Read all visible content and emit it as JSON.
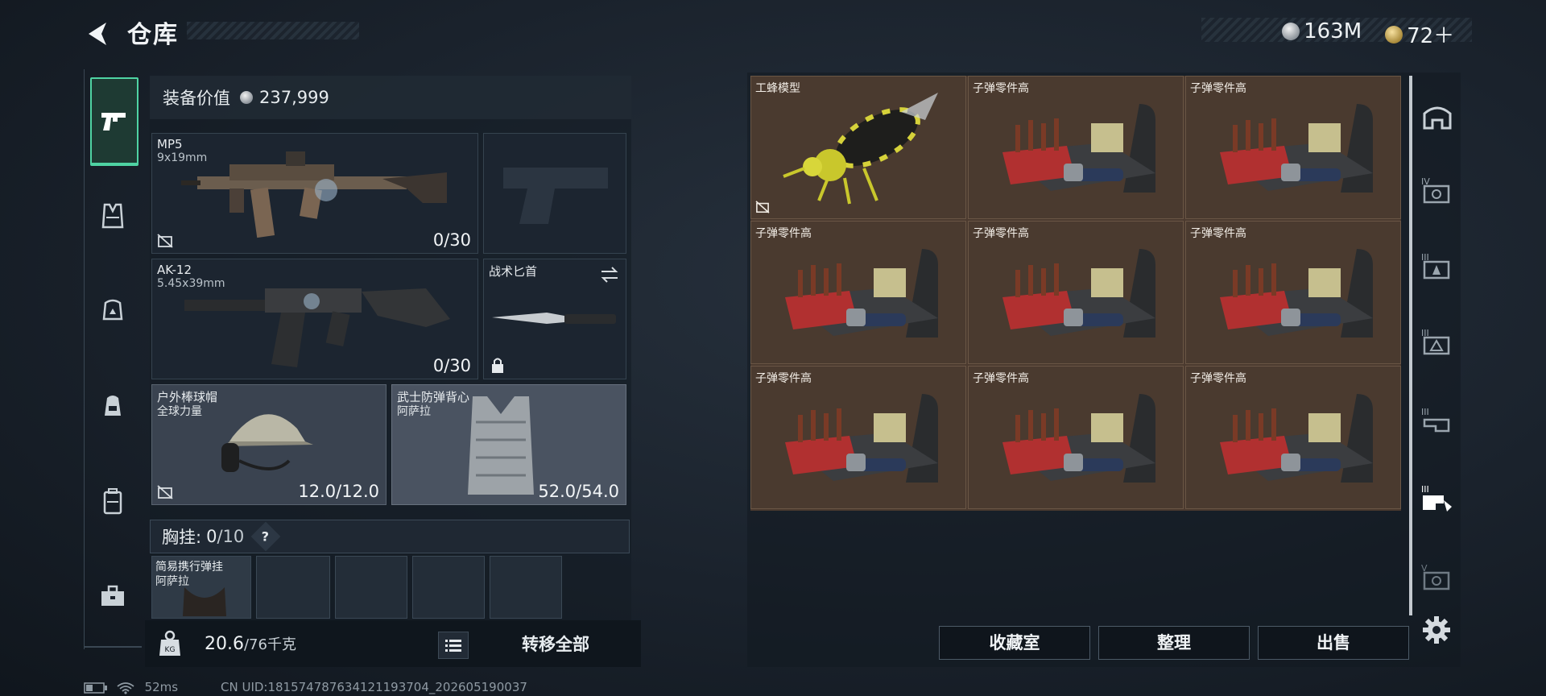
{
  "header": {
    "title": "仓库",
    "currency": [
      {
        "icon": "silver-coin-icon",
        "value": "163M"
      },
      {
        "icon": "gold-coin-icon",
        "value": "72＋"
      }
    ]
  },
  "sidebar": {
    "items": [
      {
        "name": "weapons-tab",
        "icon": "pistol-icon",
        "active": true
      },
      {
        "name": "armor-tab",
        "icon": "vest-icon",
        "active": false
      },
      {
        "name": "helmet-tab",
        "icon": "helmet-icon",
        "active": false
      },
      {
        "name": "backpack-tab",
        "icon": "backpack-icon",
        "active": false
      },
      {
        "name": "container-tab",
        "icon": "case-icon",
        "active": false
      },
      {
        "name": "toolbox-tab",
        "icon": "toolbox-icon",
        "active": false
      }
    ]
  },
  "equipment": {
    "value_label": "装备价值",
    "value": "237,999",
    "slots": [
      {
        "name": "MP5",
        "sub": "9x19mm",
        "count": "0/30"
      },
      {
        "name": "",
        "sub": "",
        "count": ""
      },
      {
        "name": "AK-12",
        "sub": "5.45x39mm",
        "count": "0/30"
      },
      {
        "name": "战术匕首",
        "sub": "",
        "count": ""
      },
      {
        "name": "户外棒球帽",
        "sub": "全球力量",
        "count": "12.0/12.0"
      },
      {
        "name": "武士防弹背心",
        "sub": "阿萨拉",
        "count": "52.0/54.0"
      }
    ],
    "chest_rig": {
      "label": "胸挂:",
      "used": "0",
      "capacity": "/10",
      "help": "?"
    },
    "chest_item": {
      "name": "简易携行弹挂",
      "sub": "阿萨拉"
    }
  },
  "footer": {
    "weight_current": "20.6",
    "weight_total": "/76千克",
    "transfer_all": "转移全部"
  },
  "status": {
    "ping": "52ms",
    "uid": "CN UID:1815747876341211937​04_202605190037"
  },
  "storage": {
    "items": [
      {
        "label": "工蜂模型",
        "kind": "wasp"
      },
      {
        "label": "子弹零件高",
        "kind": "ammo"
      },
      {
        "label": "子弹零件高",
        "kind": "ammo"
      },
      {
        "label": "子弹零件高",
        "kind": "ammo"
      },
      {
        "label": "子弹零件高",
        "kind": "ammo"
      },
      {
        "label": "子弹零件高",
        "kind": "ammo"
      },
      {
        "label": "子弹零件高",
        "kind": "ammo"
      },
      {
        "label": "子弹零件高",
        "kind": "ammo"
      },
      {
        "label": "子弹零件高",
        "kind": "ammo"
      }
    ],
    "actions": {
      "collection": "收藏室",
      "organize": "整理",
      "sell": "出售"
    }
  },
  "filters": [
    {
      "icon": "helmet-filter-icon"
    },
    {
      "icon": "tier-iv-filter-icon"
    },
    {
      "icon": "tier-iii-filter-icon"
    },
    {
      "icon": "tier-ii-filter-icon"
    },
    {
      "icon": "tier-i-filter-icon"
    },
    {
      "icon": "tier-i-hand-filter-icon"
    },
    {
      "icon": "tier-v-filter-icon"
    }
  ]
}
